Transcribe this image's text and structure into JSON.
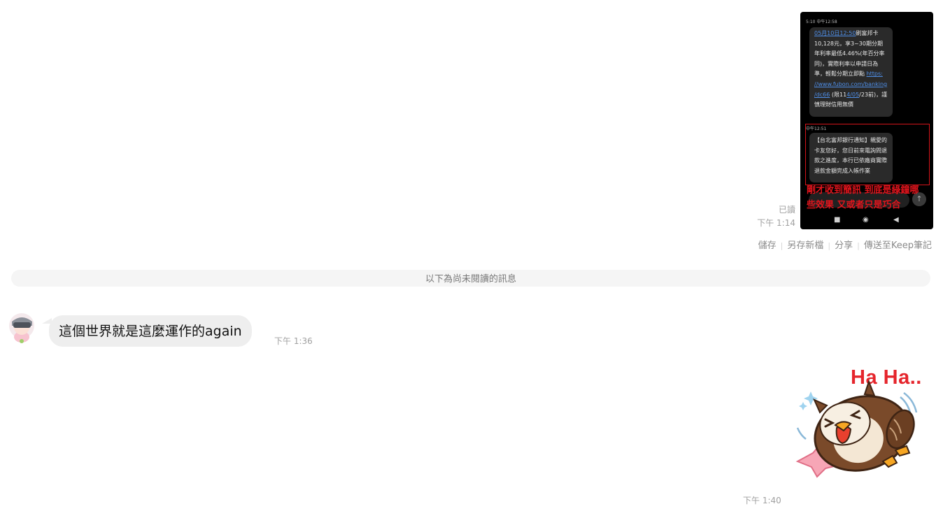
{
  "sent_image": {
    "sms1_status": "5:10 中午12:58",
    "sms1_lines": [
      "05月10日12:50刷富邦卡",
      "10,128元，享3~30期分期",
      "年利率最低4.46%(年百分率",
      "同)，實際利率以申請日為",
      "準，輕鬆分期立即點 https:",
      "//www.fubon.com/banking",
      "/dc66 (限114/05/23前)，謹",
      "慎理財信用無價"
    ],
    "sms2_status": "中午12:51",
    "sms2_lines": [
      "【台北富邦銀行通知】親愛的",
      "卡友您好，您日前來電詢問退",
      "款之進度，本行已依廠商實際",
      "退款金額完成入帳作業"
    ],
    "red_caption_lines": [
      "剛才收到簡訊 到底是綠鐘哪",
      "些效果 又或者只是巧合"
    ],
    "read_label": "已讀",
    "time": "下午 1:14"
  },
  "actions": {
    "save": "儲存",
    "save_as": "另存新檔",
    "share": "分享",
    "send_keep": "傳送至Keep筆記"
  },
  "unread_divider": "以下為尚未閱讀的訊息",
  "received": {
    "text": "這個世界就是這麼運作的again",
    "time": "下午 1:36"
  },
  "sticker": {
    "text": "Ha Ha..",
    "time": "下午 1:40"
  },
  "colors": {
    "bubble_bg": "#eeeeee",
    "divider_bg": "#f5f5f5",
    "accent_red": "#e5252c"
  }
}
